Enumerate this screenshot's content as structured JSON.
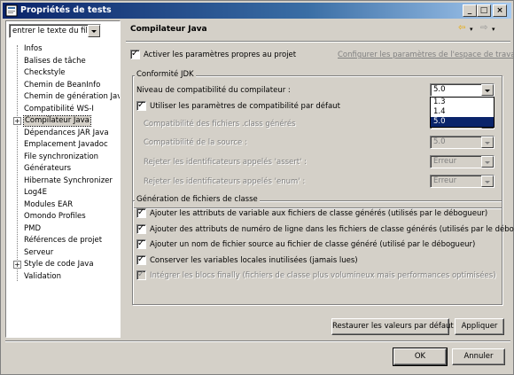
{
  "window": {
    "title": "Propriétés de tests",
    "buttons": {
      "minimize": "_",
      "maximize": "□",
      "close": "×"
    }
  },
  "filter": {
    "value": "entrer le texte du filt"
  },
  "tree": {
    "items": [
      {
        "label": "Infos",
        "expandable": false
      },
      {
        "label": "Balises de tâche",
        "expandable": false
      },
      {
        "label": "Checkstyle",
        "expandable": false
      },
      {
        "label": "Chemin de BeanInfo",
        "expandable": false
      },
      {
        "label": "Chemin de génération Java",
        "expandable": false
      },
      {
        "label": "Compatibilité WS-I",
        "expandable": false
      },
      {
        "label": "Compilateur Java",
        "expandable": true,
        "selected": true
      },
      {
        "label": "Dépendances JAR Java",
        "expandable": false
      },
      {
        "label": "Emplacement Javadoc",
        "expandable": false
      },
      {
        "label": "File synchronization",
        "expandable": false
      },
      {
        "label": "Générateurs",
        "expandable": false
      },
      {
        "label": "Hibernate Synchronizer",
        "expandable": false
      },
      {
        "label": "Log4E",
        "expandable": false
      },
      {
        "label": "Modules EAR",
        "expandable": false
      },
      {
        "label": "Omondo Profiles",
        "expandable": false
      },
      {
        "label": "PMD",
        "expandable": false
      },
      {
        "label": "Références de projet",
        "expandable": false
      },
      {
        "label": "Serveur",
        "expandable": false
      },
      {
        "label": "Style de code Java",
        "expandable": true
      },
      {
        "label": "Validation",
        "expandable": false
      }
    ]
  },
  "page": {
    "title": "Compilateur Java",
    "enable_project_settings": {
      "label": "Activer les paramètres propres au projet",
      "checked": true
    },
    "configure_workspace_link": "Configurer les paramètres de l'espace de travail...",
    "jdk": {
      "group_label": "Conformité JDK",
      "compiler_level_label": "Niveau de compatibilité du compilateur :",
      "compiler_level_value": "5.0",
      "compiler_level_options": [
        "1.3",
        "1.4",
        "5.0"
      ],
      "use_default": {
        "label": "Utiliser les paramètres de compatibilité par défaut",
        "checked": true
      },
      "class_compat_label": "Compatibilité des fichiers .class générés",
      "source_compat_label": "Compatibilité de la source :",
      "source_compat_value": "5.0",
      "assert_label": "Rejeter les identificateurs appelés 'assert' :",
      "assert_value": "Erreur",
      "enum_label": "Rejeter les identificateurs appelés 'enum' :",
      "enum_value": "Erreur"
    },
    "classgen": {
      "group_label": "Génération de fichiers de classe",
      "options": [
        {
          "label": "Ajouter les attributs de variable aux fichiers de classe générés (utilisés par le débogueur)",
          "checked": true,
          "disabled": false
        },
        {
          "label": "Ajouter des attributs de numéro de ligne dans les fichiers de classe générés (utilisés par le débogueur)",
          "checked": true,
          "disabled": false
        },
        {
          "label": "Ajouter un nom de fichier source au fichier de classe généré (utilisé par le débogueur)",
          "checked": true,
          "disabled": false
        },
        {
          "label": "Conserver les variables locales inutilisées (jamais lues)",
          "checked": true,
          "disabled": false
        },
        {
          "label": "Intégrer les blocs finally (fichiers de classe plus volumineux mais performances optimisées)",
          "checked": true,
          "disabled": true
        }
      ]
    },
    "restore_defaults": "Restaurer les valeurs par défaut",
    "apply": "Appliquer"
  },
  "dialog": {
    "ok": "OK",
    "cancel": "Annuler"
  }
}
